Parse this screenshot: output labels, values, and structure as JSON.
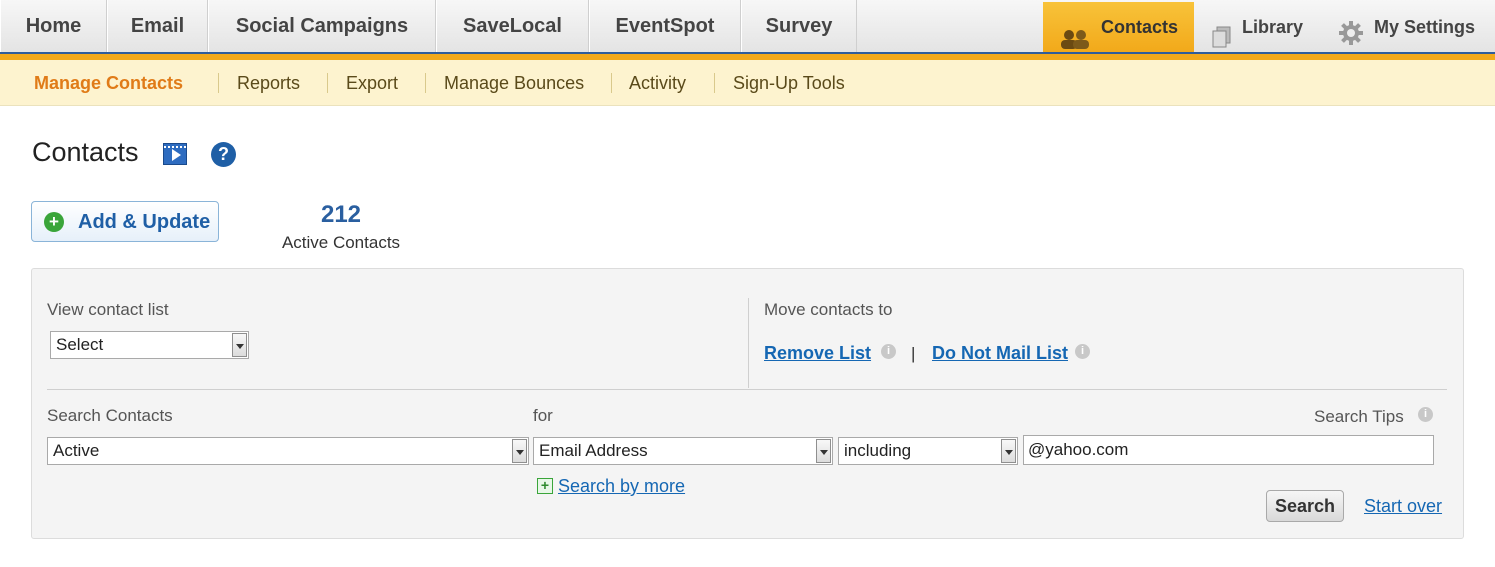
{
  "topnav": {
    "tabs": [
      "Home",
      "Email",
      "Social Campaigns",
      "SaveLocal",
      "EventSpot",
      "Survey"
    ],
    "contacts": "Contacts",
    "library": "Library",
    "settings": "My Settings"
  },
  "subnav": {
    "items": [
      "Manage Contacts",
      "Reports",
      "Export",
      "Manage Bounces",
      "Activity",
      "Sign-Up Tools"
    ]
  },
  "page": {
    "title": "Contacts",
    "add_update": "Add & Update",
    "count": "212",
    "count_label": "Active Contacts"
  },
  "view_list": {
    "label": "View contact list",
    "value": "Select"
  },
  "move": {
    "label": "Move contacts to",
    "separator": "|",
    "remove": "Remove List",
    "do_not_mail": "Do Not Mail List"
  },
  "search": {
    "label": "Search Contacts",
    "for": "for",
    "tips": "Search Tips",
    "status": "Active",
    "field": "Email Address",
    "operator": "including",
    "query": "@yahoo.com",
    "more": "Search by more",
    "button": "Search",
    "start_over": "Start over"
  },
  "colors": {
    "accent_gold": "#f2a91a",
    "link_blue": "#1567b3",
    "active_orange": "#e07b18"
  }
}
